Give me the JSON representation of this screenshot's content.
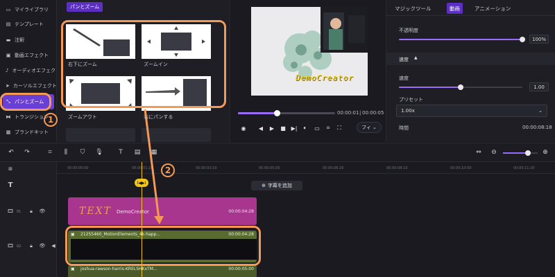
{
  "sidebar": {
    "items": [
      {
        "label": "マイライブラリ",
        "icon": "folder-icon"
      },
      {
        "label": "テンプレート",
        "icon": "template-icon"
      },
      {
        "label": "注釈",
        "icon": "annotation-icon"
      },
      {
        "label": "動画エフェクト",
        "icon": "video-effect-icon"
      },
      {
        "label": "オーディオエフェクト",
        "icon": "audio-effect-icon"
      },
      {
        "label": "カーソルエフェクト",
        "icon": "cursor-effect-icon"
      },
      {
        "label": "パンとズーム",
        "icon": "pan-zoom-icon",
        "active": true
      },
      {
        "label": "トランジション",
        "icon": "transition-icon"
      },
      {
        "label": "ブランドキット",
        "icon": "brand-kit-icon"
      }
    ]
  },
  "media": {
    "tag": "パンとズーム",
    "thumbs": [
      {
        "label": "右下にズーム"
      },
      {
        "label": "ズームイン"
      },
      {
        "label": "ズームアウト"
      },
      {
        "label": "右にパンする"
      }
    ]
  },
  "preview": {
    "overlay_text": "DemoCreator",
    "current_time": "00:00:01",
    "total_time": "00:00:05",
    "progress": 0.4,
    "fit_label": "フィ"
  },
  "props": {
    "tabs": [
      "マジックツール",
      "動画",
      "アニメーション"
    ],
    "active_tab": 1,
    "opacity_label": "不透明度",
    "opacity_value": "100%",
    "opacity_fraction": 1.0,
    "speed_section": "速度",
    "speed_label": "速度",
    "speed_value": "1.00",
    "speed_fraction": 0.5,
    "preset_label": "プリセット",
    "preset_value": "1.00x",
    "time_label": "時間",
    "time_value": "00:00:08:18"
  },
  "timeline": {
    "ruler": [
      "00:00:00:00",
      "00:00:01:20",
      "00:00:03:10",
      "00:00:05:00",
      "00:00:06:20",
      "00:00:08:10",
      "00:00:10:00",
      "00:00:11:20"
    ],
    "add_subtitle": "字幕を追加",
    "tracks": [
      {
        "num": "01"
      },
      {
        "num": "02"
      }
    ],
    "text_clip": {
      "label": "TEXT",
      "title": "DemoCreator",
      "duration": "00:00:04:28"
    },
    "video_clip": {
      "title": "21255460_MotionElements_4k-happ...",
      "duration": "00:00:04:28"
    },
    "video_clip2": {
      "title": "joshua-rawson-harris-KRELSHKxTM...",
      "duration": "00:00:05:00"
    },
    "playhead_label": "I◀▶I"
  },
  "annotations": {
    "one": "1",
    "two": "2"
  },
  "colors": {
    "accent": "#6a3fd6",
    "annotation": "#f59a54",
    "playhead": "#f0c419",
    "text_clip": "#a8368f",
    "video_clip": "#5a6b2f"
  }
}
